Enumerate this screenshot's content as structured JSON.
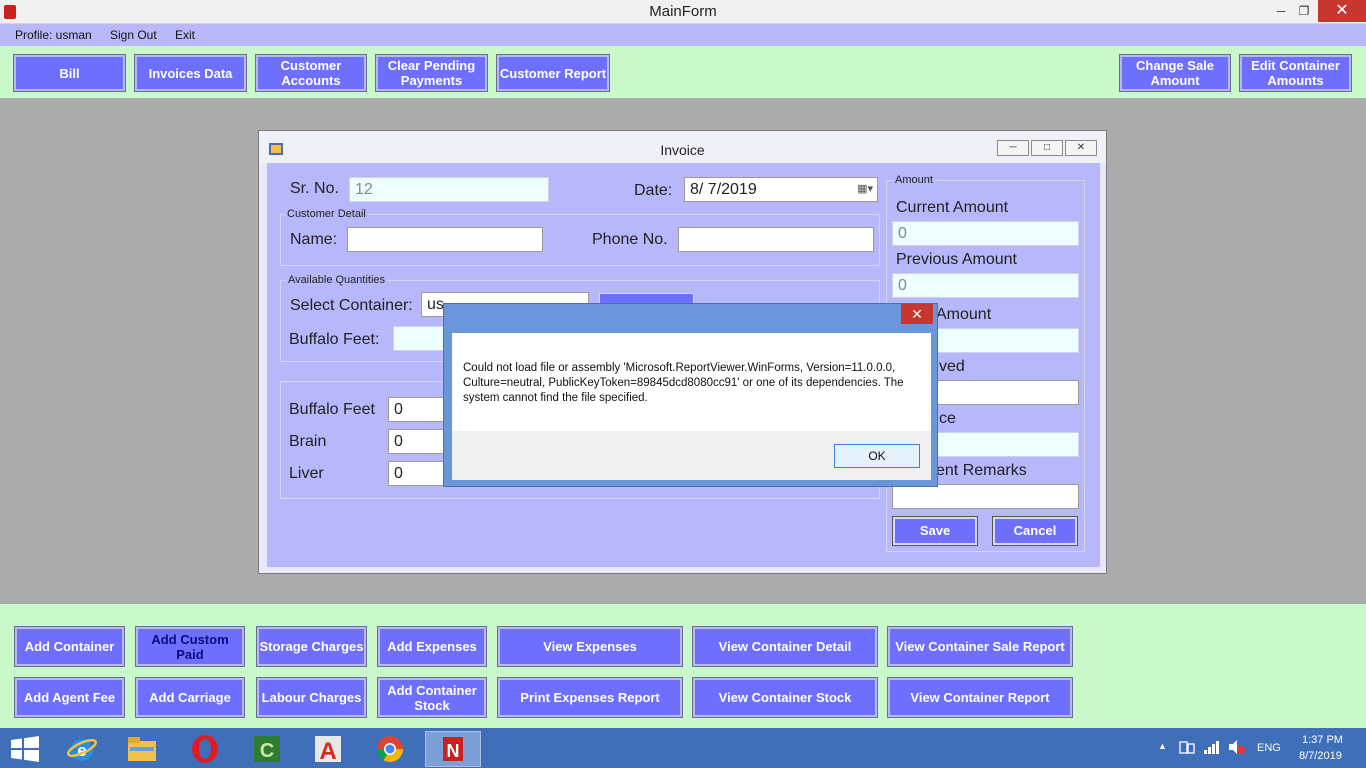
{
  "window": {
    "title": "MainForm"
  },
  "menu": {
    "profile": "Profile: usman",
    "sign_out": "Sign Out",
    "exit": "Exit"
  },
  "top_buttons": {
    "bill": "Bill",
    "invoices_data": "Invoices Data",
    "customer_accounts": "Customer Accounts",
    "clear_pending": "Clear Pending Payments",
    "customer_report": "Customer Report",
    "change_sale": "Change Sale Amount",
    "edit_container": "Edit Container Amounts"
  },
  "invoice": {
    "title": "Invoice",
    "sr_label": "Sr. No.",
    "sr_value": "12",
    "date_label": "Date:",
    "date_value": "8/  7/2019",
    "customer_group": "Customer Detail",
    "name_label": "Name:",
    "name_value": "",
    "phone_label": "Phone No.",
    "phone_value": "",
    "available_group": "Available Quantities",
    "select_container_label": "Select Container:",
    "select_container_value": "us",
    "buffalo_feet_label": "Buffalo Feet:",
    "qty_buffalo_label": "Buffalo Feet",
    "qty_buffalo_value": "0",
    "brain_label": "Brain",
    "brain_value": "0",
    "liver_label": "Liver",
    "liver_value": "0",
    "amount_group": "Amount",
    "current_amount_label": "Current Amount",
    "current_amount_value": "0",
    "previous_amount_label": "Previous Amount",
    "previous_amount_value": "0",
    "total_amount_label_partial": "Amount",
    "received_label_partial": "ved",
    "balance_label_partial": "ce",
    "remarks_label_partial": "ent Remarks",
    "save": "Save",
    "cancel": "Cancel"
  },
  "dialog": {
    "message": "Could not load file or assembly 'Microsoft.ReportViewer.WinForms, Version=11.0.0.0, Culture=neutral, PublicKeyToken=89845dcd8080cc91' or one of its dependencies. The system cannot find the file specified.",
    "ok": "OK"
  },
  "bottom_buttons": {
    "add_container": "Add Container",
    "add_custom_paid": "Add Custom Paid",
    "storage_charges": "Storage Charges",
    "add_expenses": "Add Expenses",
    "view_expenses": "View Expenses",
    "view_container_detail": "View Container Detail",
    "view_container_sale_report": "View Container Sale Report",
    "add_agent_fee": "Add Agent Fee",
    "add_carriage": "Add Carriage",
    "labour_charges": "Labour Charges",
    "add_container_stock": "Add Container Stock",
    "print_expenses_report": "Print Expenses Report",
    "view_container_stock": "View Container Stock",
    "view_container_report": "View Container Report"
  },
  "taskbar": {
    "lang": "ENG",
    "time": "1:37 PM",
    "date": "8/7/2019"
  },
  "colors": {
    "button_blue": "#6f6fff",
    "panel_green": "#c9f9c9",
    "form_lilac": "#b7b7fb",
    "taskbar": "#3f6fb8"
  }
}
